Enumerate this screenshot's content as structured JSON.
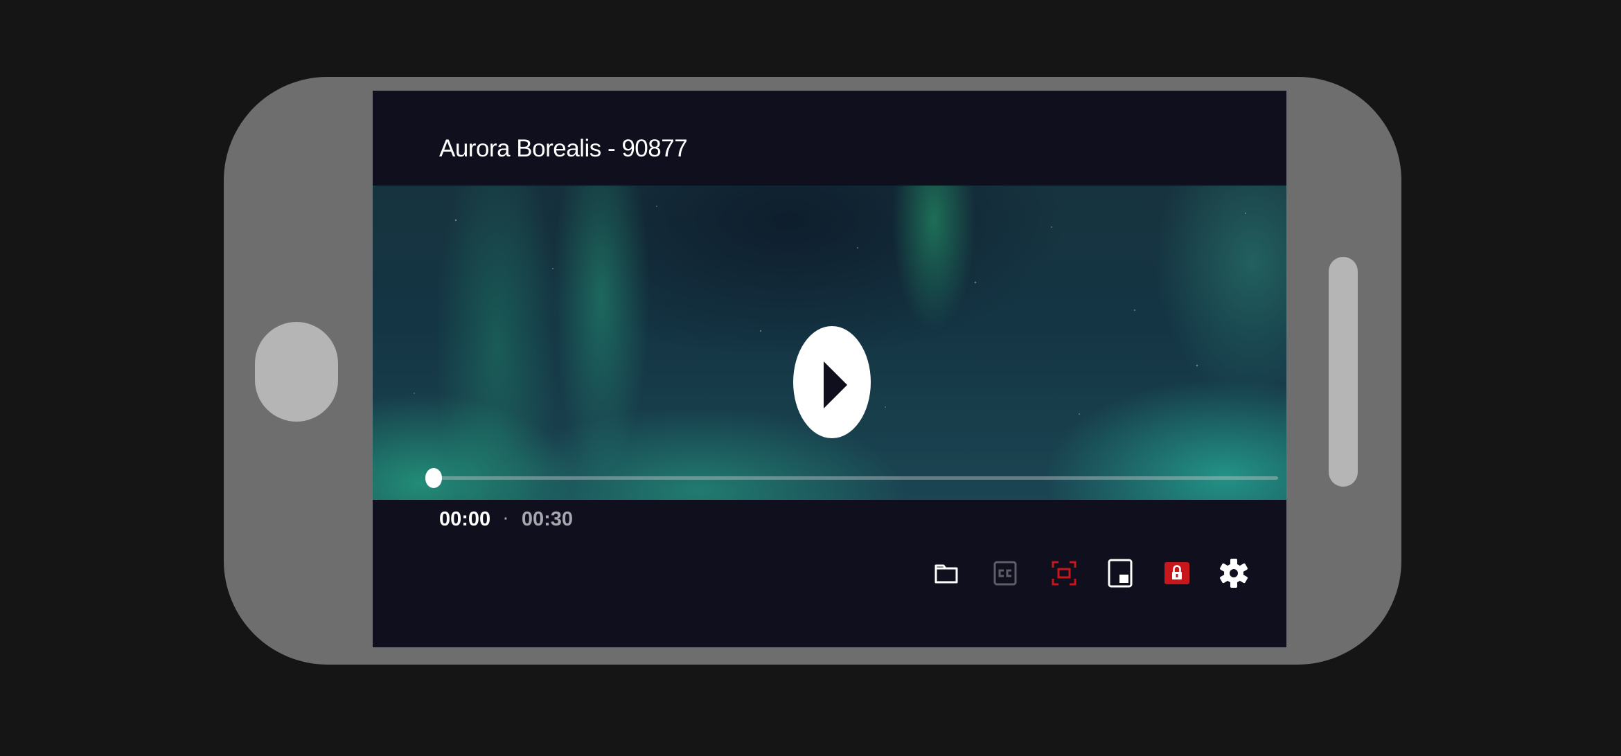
{
  "video": {
    "title": "Aurora Borealis - 90877",
    "current_time": "00:00",
    "separator": "·",
    "duration": "00:30",
    "progress_fraction": 0.0
  },
  "controls": [
    {
      "name": "folder-button",
      "icon": "folder-icon",
      "color": "#ffffff"
    },
    {
      "name": "closed-captions-button",
      "icon": "closed-captions-icon",
      "color": "#5e5e68"
    },
    {
      "name": "fullscreen-button",
      "icon": "fullscreen-icon",
      "color": "#c8161d"
    },
    {
      "name": "picture-in-picture-button",
      "icon": "picture-in-picture-icon",
      "color": "#ffffff"
    },
    {
      "name": "lock-button",
      "icon": "lock-icon",
      "color": "#c8161d"
    },
    {
      "name": "settings-button",
      "icon": "gear-icon",
      "color": "#ffffff"
    }
  ],
  "colors": {
    "screen_background": "#100f1e",
    "phone_frame": "#6e6e6e",
    "accent_red": "#c8161d",
    "disabled_gray": "#5e5e68"
  }
}
